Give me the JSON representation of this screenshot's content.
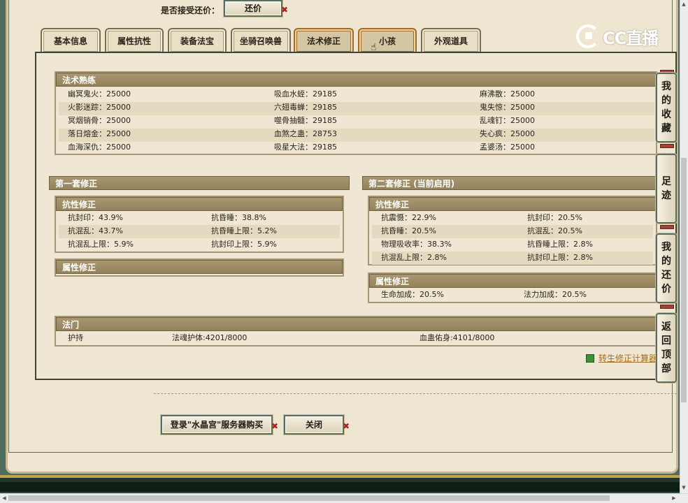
{
  "top": {
    "accept_counter_label": "是否接受还价：",
    "counter_button": "还价"
  },
  "logo": {
    "text": "CC直播"
  },
  "tabs": [
    {
      "label": "基本信息",
      "active": false
    },
    {
      "label": "属性抗性",
      "active": false
    },
    {
      "label": "装备法宝",
      "active": false
    },
    {
      "label": "坐骑召唤兽",
      "active": false
    },
    {
      "label": "法术修正",
      "active": true
    },
    {
      "label": "小孩",
      "active": false
    },
    {
      "label": "外观道具",
      "active": false
    }
  ],
  "spell_mastery": {
    "title": "法术熟练",
    "rows": [
      [
        "幽冥鬼火：25000",
        "吸血水蛭：29185",
        "麻沸散：25000"
      ],
      [
        "火影迷踪：25000",
        "六翅毒蝉：29185",
        "鬼失惊：25000"
      ],
      [
        "冥烟销骨：25000",
        "噬骨抽髓：29185",
        "乱魂钉：25000"
      ],
      [
        "落日熔金：25000",
        "血煞之蛊：28753",
        "失心疯：25000"
      ],
      [
        "血海深仇：25000",
        "吸星大法：29185",
        "孟婆汤：25000"
      ]
    ]
  },
  "set1": {
    "title": "第一套修正",
    "resist_title": "抗性修正",
    "resist_rows": [
      [
        "抗封印：43.9%",
        "抗昏睡：38.8%"
      ],
      [
        "抗混乱：43.7%",
        "抗昏睡上限：5.2%"
      ],
      [
        "抗混乱上限：5.9%",
        "抗封印上限：5.9%"
      ]
    ],
    "attr_title": "属性修正"
  },
  "set2": {
    "title": "第二套修正 (当前启用)",
    "resist_title": "抗性修正",
    "resist_rows": [
      [
        "抗震慑：22.9%",
        "抗封印：20.5%"
      ],
      [
        "抗昏睡：20.5%",
        "抗混乱：20.5%"
      ],
      [
        "物理吸收率：38.3%",
        "抗昏睡上限：2.8%"
      ],
      [
        "抗混乱上限：2.8%",
        "抗封印上限：2.8%"
      ]
    ],
    "attr_title": "属性修正",
    "attr_rows": [
      [
        "生命加成：20.5%",
        "法力加成：20.5%"
      ]
    ]
  },
  "fameng": {
    "title": "法门",
    "row": [
      "护持",
      "法魂护体:4201/8000",
      "血蛊佑身:4101/8000"
    ]
  },
  "calc_link": "转生修正计算器",
  "side_buttons": [
    {
      "label": "我的收藏",
      "chars": [
        "我",
        "的",
        "收",
        "藏"
      ]
    },
    {
      "label": "足迹",
      "chars": [
        "足",
        "迹"
      ]
    },
    {
      "label": "我的还价",
      "chars": [
        "我",
        "的",
        "还",
        "价"
      ]
    },
    {
      "label": "返回顶部",
      "chars": [
        "返",
        "回",
        "顶",
        "部"
      ]
    }
  ],
  "bottom_buttons": {
    "buy": "登录\"水晶宫\"服务器购买",
    "close": "关闭"
  },
  "colors": {
    "frame_green": "#4f6d5c",
    "panel_bg": "#efe7d3",
    "header_tan": "#a89770",
    "link_orange": "#a56a1a",
    "close_x_red": "#b02020"
  }
}
